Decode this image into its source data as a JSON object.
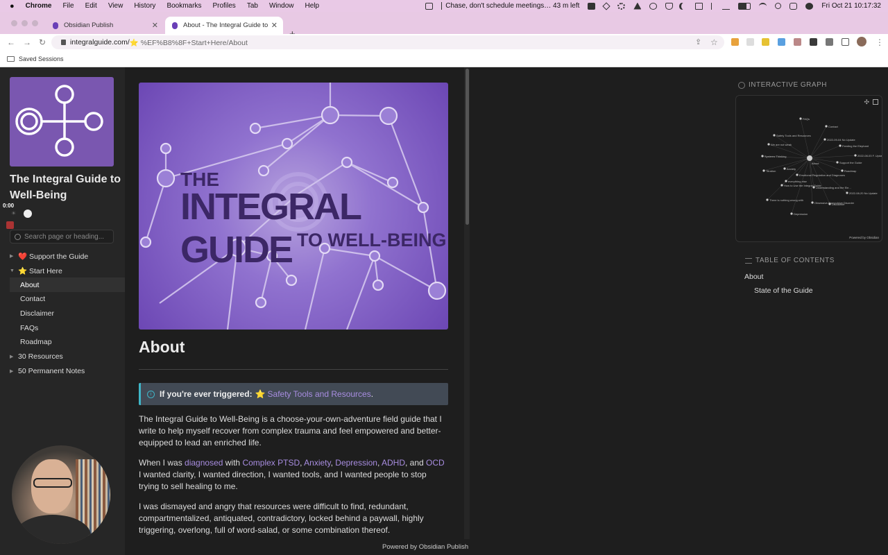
{
  "menubar": {
    "apple": "",
    "app": "Chrome",
    "menus": [
      "File",
      "Edit",
      "View",
      "History",
      "Bookmarks",
      "Profiles",
      "Tab",
      "Window",
      "Help"
    ],
    "notification": "Chase, don't schedule meetings… 43 m left",
    "datetime": "Fri Oct 21  10:17:32"
  },
  "tabs": [
    {
      "title": "Obsidian Publish"
    },
    {
      "title": "About - The Integral Guide to W"
    }
  ],
  "address": {
    "host": "integralguide.com/",
    "path": "⭐️ %EF%B8%8F+Start+Here/About"
  },
  "bookmarks": {
    "saved_sessions": "Saved Sessions"
  },
  "sidebar": {
    "site_title": "The Integral Guide to Well-Being",
    "timer": "0:00",
    "toggle_label": "☀",
    "search_placeholder": "Search page or heading...",
    "items": [
      {
        "label": "❤️ Support the Guide",
        "caret": "▶"
      },
      {
        "label": "⭐ Start Here",
        "caret": "▼"
      },
      {
        "label": "About"
      },
      {
        "label": "Contact"
      },
      {
        "label": "Disclaimer"
      },
      {
        "label": "FAQs"
      },
      {
        "label": "Roadmap"
      },
      {
        "label": "30 Resources",
        "caret": "▶"
      },
      {
        "label": "50 Permanent Notes",
        "caret": "▶"
      }
    ]
  },
  "hero": {
    "line1": "THE",
    "line2": "INTEGRAL GUIDE",
    "line3": "TO WELL-BEING"
  },
  "content": {
    "heading": "About",
    "callout_bold": "If you're ever triggered:",
    "callout_star": "⭐",
    "callout_link": "Safety Tools and Resources",
    "callout_end": ".",
    "p1": "The Integral Guide to Well-Being is a choose-your-own-adventure field guide that I write to help myself recover from complex trauma and feel empowered and better-equipped to lead an enriched life.",
    "p2_start": "When I was ",
    "p2_l1": "diagnosed",
    "p2_with": " with ",
    "p2_l2": "Complex PTSD",
    "p2_c1": ", ",
    "p2_l3": "Anxiety",
    "p2_c2": ", ",
    "p2_l4": "Depression",
    "p2_c3": ", ",
    "p2_l5": "ADHD",
    "p2_and": ", and ",
    "p2_l6": "OCD",
    "p2_end": " I wanted clarity, I wanted direction, I wanted tools, and I wanted people to stop trying to sell healing to me.",
    "p3": "I was dismayed and angry that resources were difficult to find, redundant, compartmentalized, antiquated, contradictory, locked behind a paywall, highly triggering, overlong, full of word-salad, or some combination thereof."
  },
  "footer": "Powered by Obsidian Publish",
  "right": {
    "graph_title": "INTERACTIVE GRAPH",
    "graph_nodes": [
      "FAQs",
      "Contact",
      "Safety Tools and Resources",
      "2022-09-04 No Update",
      "We are not weak",
      "Feeding the Elephant",
      "Systems Thinking",
      "2022-08-03 F. Update",
      "About",
      "Support the Guide",
      "Titration",
      "Anxiety",
      "Roadmap",
      "Emotional Regulation and Diagnoses",
      "everything else",
      "How to Use the Integral Guide",
      "Understanding and the Ele...",
      "2022-08-20 No Update",
      "There is nothing wrong with",
      "Obsessive-Compulsive Disorder",
      "Depression",
      "Disclaimer"
    ],
    "graph_powered": "Powered by Obsidian",
    "toc_title": "TABLE OF CONTENTS",
    "toc": [
      "About",
      "State of the Guide"
    ]
  }
}
